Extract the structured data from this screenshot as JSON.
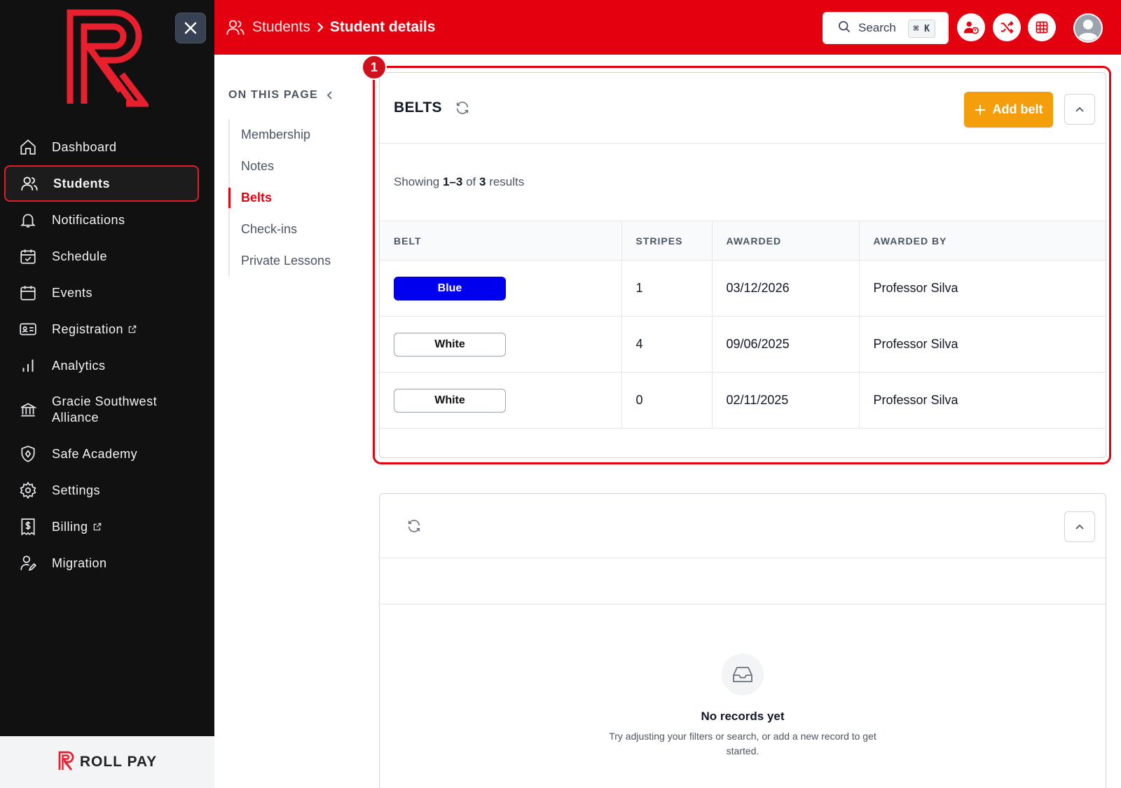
{
  "app": {
    "brand_name": "ROLL PAY",
    "colors": {
      "brand_red": "#e3000f",
      "accent_orange": "#f59e0b",
      "sidebar_bg": "#111111"
    }
  },
  "sidebar": {
    "items": [
      {
        "label": "Dashboard",
        "icon": "home-icon"
      },
      {
        "label": "Students",
        "icon": "users-icon",
        "active": true
      },
      {
        "label": "Notifications",
        "icon": "bell-icon"
      },
      {
        "label": "Schedule",
        "icon": "calendar-check-icon"
      },
      {
        "label": "Events",
        "icon": "calendar-icon"
      },
      {
        "label": "Registration",
        "icon": "id-card-icon",
        "external": true
      },
      {
        "label": "Analytics",
        "icon": "bar-chart-icon"
      },
      {
        "label": "Gracie Southwest Alliance",
        "icon": "bank-icon"
      },
      {
        "label": "Safe Academy",
        "icon": "shield-icon"
      },
      {
        "label": "Settings",
        "icon": "gear-icon"
      },
      {
        "label": "Billing",
        "icon": "invoice-icon",
        "external": true
      },
      {
        "label": "Migration",
        "icon": "user-edit-icon"
      }
    ]
  },
  "header": {
    "breadcrumb": {
      "parent": "Students",
      "current": "Student details"
    },
    "search": {
      "label": "Search",
      "shortcut": "⌘ K"
    }
  },
  "on_this_page": {
    "title": "ON THIS PAGE",
    "items": [
      {
        "label": "Membership"
      },
      {
        "label": "Notes"
      },
      {
        "label": "Belts",
        "active": true
      },
      {
        "label": "Check-ins"
      },
      {
        "label": "Private Lessons"
      }
    ]
  },
  "highlight": {
    "number": "1"
  },
  "belts": {
    "title": "BELTS",
    "add_button": "Add belt",
    "showing": {
      "prefix": "Showing",
      "range": "1–3",
      "of": "of",
      "total": "3",
      "suffix": "results"
    },
    "columns": [
      "BELT",
      "STRIPES",
      "AWARDED",
      "AWARDED BY"
    ],
    "rows": [
      {
        "belt": "Blue",
        "belt_color": "#0000ee",
        "stripes": "1",
        "awarded": "03/12/2026",
        "awarded_by": "Professor Silva"
      },
      {
        "belt": "White",
        "belt_color": "#ffffff",
        "stripes": "4",
        "awarded": "09/06/2025",
        "awarded_by": "Professor Silva"
      },
      {
        "belt": "White",
        "belt_color": "#ffffff",
        "stripes": "0",
        "awarded": "02/11/2025",
        "awarded_by": "Professor Silva"
      }
    ]
  },
  "empty_state": {
    "title": "No records yet",
    "description": "Try adjusting your filters or search, or add a new record to get started."
  }
}
